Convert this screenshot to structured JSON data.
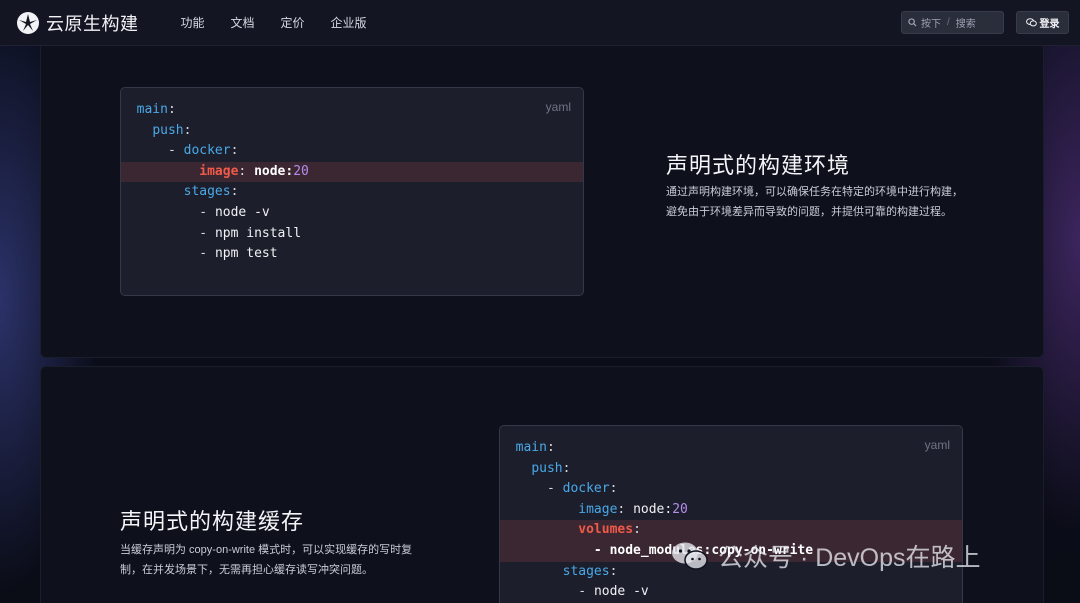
{
  "nav": {
    "brand": "云原生构建",
    "links": [
      "功能",
      "文档",
      "定价",
      "企业版"
    ],
    "search": {
      "prefix": "按下",
      "key": "/",
      "suffix": "搜索"
    },
    "login": "登录"
  },
  "section1": {
    "code": {
      "lang": "yaml",
      "lines": {
        "l1": "main",
        "l2": "push",
        "l3": "docker",
        "l4k": "image",
        "l4v": "node",
        "l4n": "20",
        "l5": "stages",
        "l6": "node -v",
        "l7": "npm install",
        "l8": "npm test"
      }
    },
    "title": "声明式的构建环境",
    "desc": "通过声明构建环境，可以确保任务在特定的环境中进行构建，避免由于环境差异而导致的问题，并提供可靠的构建过程。"
  },
  "section2": {
    "code": {
      "lang": "yaml",
      "lines": {
        "l1": "main",
        "l2": "push",
        "l3": "docker",
        "l4k": "image",
        "l4v": "node",
        "l4n": "20",
        "l5k": "volumes",
        "l6": "node_modules:copy-on-write",
        "l7": "stages",
        "l8": "node -v"
      }
    },
    "title": "声明式的构建缓存",
    "desc": "当缓存声明为 copy-on-write 模式时，可以实现缓存的写时复制，在并发场景下，无需再担心缓存读写冲突问题。"
  },
  "watermark": "公众号 · DevOps在路上"
}
